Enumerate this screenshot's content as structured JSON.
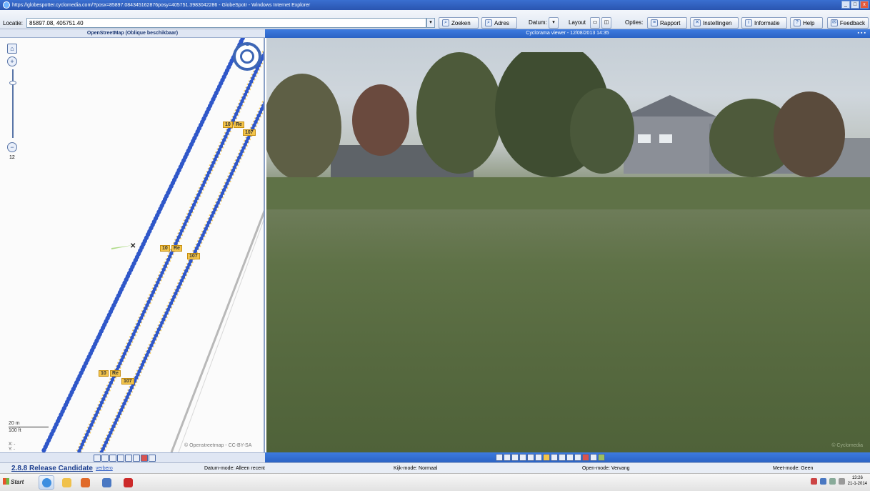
{
  "window": {
    "title": "https://globespotter.cyclomedia.com/?posx=85897.084345162876posy=405751.3983042286 - GlobeSpotr - Windows Internet Explorer",
    "controls": [
      "_",
      "□",
      "x"
    ]
  },
  "toolbar": {
    "location_label": "Locatie:",
    "location_value": "85897.08, 405751.40",
    "search_label": "Zoeken",
    "address_label": "Adres",
    "date_label": "Datum:",
    "layout_label": "Layout",
    "options_label": "Opties:",
    "report_label": "Rapport",
    "settings_label": "Instellingen",
    "info_label": "Informatie",
    "help_label": "Help",
    "feedback_label": "Feedback"
  },
  "map": {
    "header": "OpenStreetMap (Oblique beschikbaar)",
    "zoom_level": "12",
    "scale_metric": "20 m",
    "scale_imperial": "100 ft",
    "coord_x": "X: -",
    "coord_y": "Y: -",
    "attribution": "© Openstreetmap - CC-BY-SA",
    "labels": [
      "10",
      "Re",
      "107",
      "10",
      "Re",
      "107",
      "10",
      "Re",
      "107"
    ]
  },
  "viewer": {
    "header": "Cyclorama viewer - 12/08/2013 14:35",
    "watermark": "© Cyclomedia"
  },
  "status": {
    "version": "2.8.8 Release Candidate",
    "version_link": "verbero",
    "date_mode": "Datum-mode:  Alleen recent",
    "view_mode": "Kijk-mode:  Normaal",
    "open_mode": "Open-mode:  Vervang",
    "measure_mode": "Meet-mode:  Geen"
  },
  "taskbar": {
    "start_label": "Start",
    "time": "13:26",
    "date": "21-1-2014"
  },
  "colors": {
    "title_bar": "#2a55b0",
    "viewer_header": "#2b63c4",
    "track_blue": "#2f57c9",
    "track_yellow": "#f3c44a"
  }
}
